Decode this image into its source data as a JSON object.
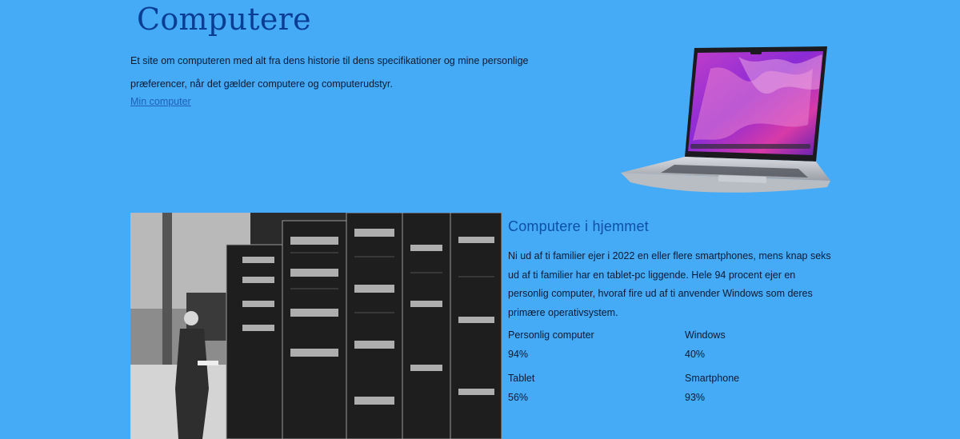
{
  "hero": {
    "title": "Computere",
    "description": "Et site om computeren med alt fra dens historie til dens specifikationer og mine personlige præferencer, når det gælder computere og computerudstyr.",
    "link": "Min computer"
  },
  "section": {
    "title": "Computere i hjemmet",
    "text": "Ni ud af ti familier ejer i 2022 en eller flere smartphones, mens knap seks ud af ti familier har en tablet-pc liggende. Hele 94 procent ejer en personlig computer, hvoraf fire ud af ti anvender Windows som deres primære operativsystem.",
    "stats": [
      {
        "label": "Personlig computer",
        "value": "94%"
      },
      {
        "label": "Windows",
        "value": "40%"
      },
      {
        "label": "Tablet",
        "value": "56%"
      },
      {
        "label": "Smartphone",
        "value": "93%"
      }
    ]
  },
  "colors": {
    "background": "#45abf6",
    "title": "#0a3e94",
    "link": "#1f5fb8"
  },
  "images": {
    "hero": "laptop-image",
    "section": "vintage-mainframe-photo"
  }
}
